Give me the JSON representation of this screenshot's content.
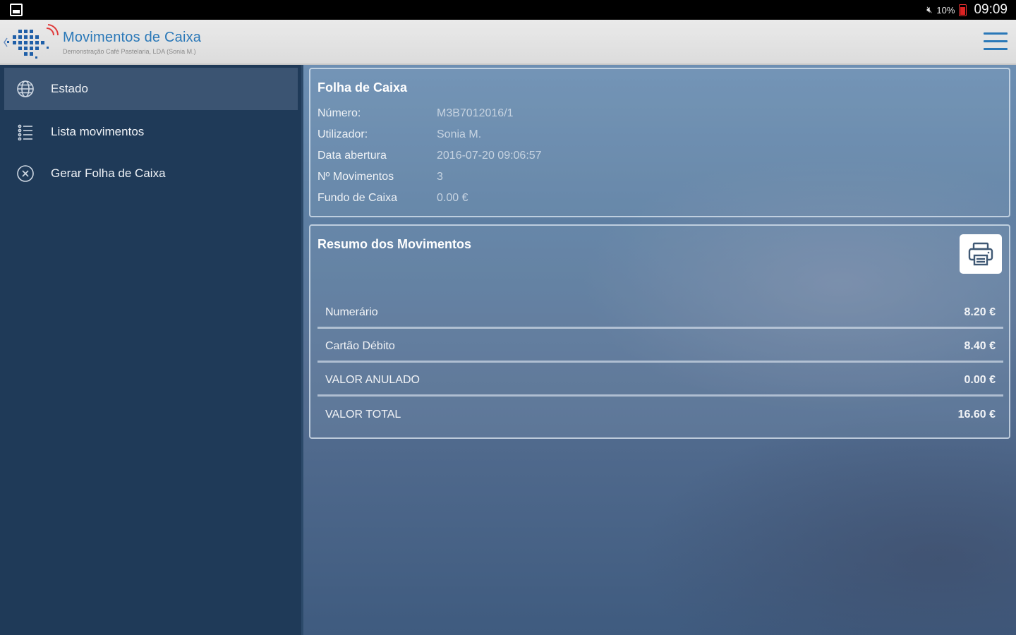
{
  "status_bar": {
    "battery": "10%",
    "time": "09:09",
    "icons": [
      "gallery-icon",
      "mute-icon",
      "battery-low-icon"
    ]
  },
  "app": {
    "title": "Movimentos de Caixa",
    "subtitle": "Demonstração Café Pastelaria, LDA (Sonia M.)"
  },
  "sidebar": {
    "items": [
      {
        "label": "Estado",
        "icon": "globe-icon",
        "active": true
      },
      {
        "label": "Lista movimentos",
        "icon": "list-icon",
        "active": false
      },
      {
        "label": "Gerar Folha de Caixa",
        "icon": "close-circle-icon",
        "active": false
      }
    ]
  },
  "folha": {
    "title": "Folha de Caixa",
    "rows": [
      {
        "label": "Número:",
        "value": "M3B7012016/1"
      },
      {
        "label": "Utilizador:",
        "value": "Sonia M."
      },
      {
        "label": "Data abertura",
        "value": "2016-07-20 09:06:57"
      },
      {
        "label": "Nº Movimentos",
        "value": "3"
      },
      {
        "label": "Fundo de Caixa",
        "value": "0.00 €"
      }
    ]
  },
  "resumo": {
    "title": "Resumo dos Movimentos",
    "print_icon": "printer-icon",
    "rows": [
      {
        "label": "Numerário",
        "amount": "8.20 €"
      },
      {
        "label": "Cartão Débito",
        "amount": "8.40 €"
      },
      {
        "label": "VALOR ANULADO",
        "amount": "0.00 €"
      },
      {
        "label": "VALOR TOTAL",
        "amount": "16.60 €"
      }
    ]
  }
}
